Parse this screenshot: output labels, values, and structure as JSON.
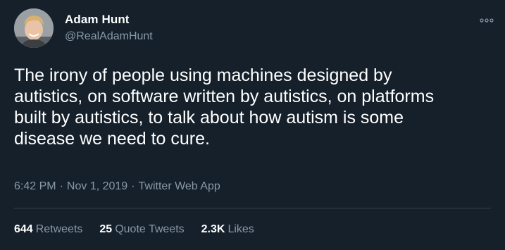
{
  "author": {
    "display_name": "Adam Hunt",
    "handle": "@RealAdamHunt"
  },
  "tweet": {
    "text": "The irony of people using machines designed by\nautistics, on software written by autistics, on platforms\nbuilt by autistics, to talk about how autism is some\ndisease we need to cure."
  },
  "meta": {
    "time": "6:42 PM",
    "separator": "·",
    "date": "Nov 1, 2019",
    "source": "Twitter Web App"
  },
  "stats": {
    "retweets_count": "644",
    "retweets_label": "Retweets",
    "quote_count": "25",
    "quote_label": "Quote Tweets",
    "likes_count": "2.3K",
    "likes_label": "Likes"
  },
  "icons": {
    "more": "more-options-icon"
  },
  "colors": {
    "background": "#15202b",
    "primary_text": "#ffffff",
    "secondary_text": "#8899a6",
    "divider": "#38444d"
  }
}
